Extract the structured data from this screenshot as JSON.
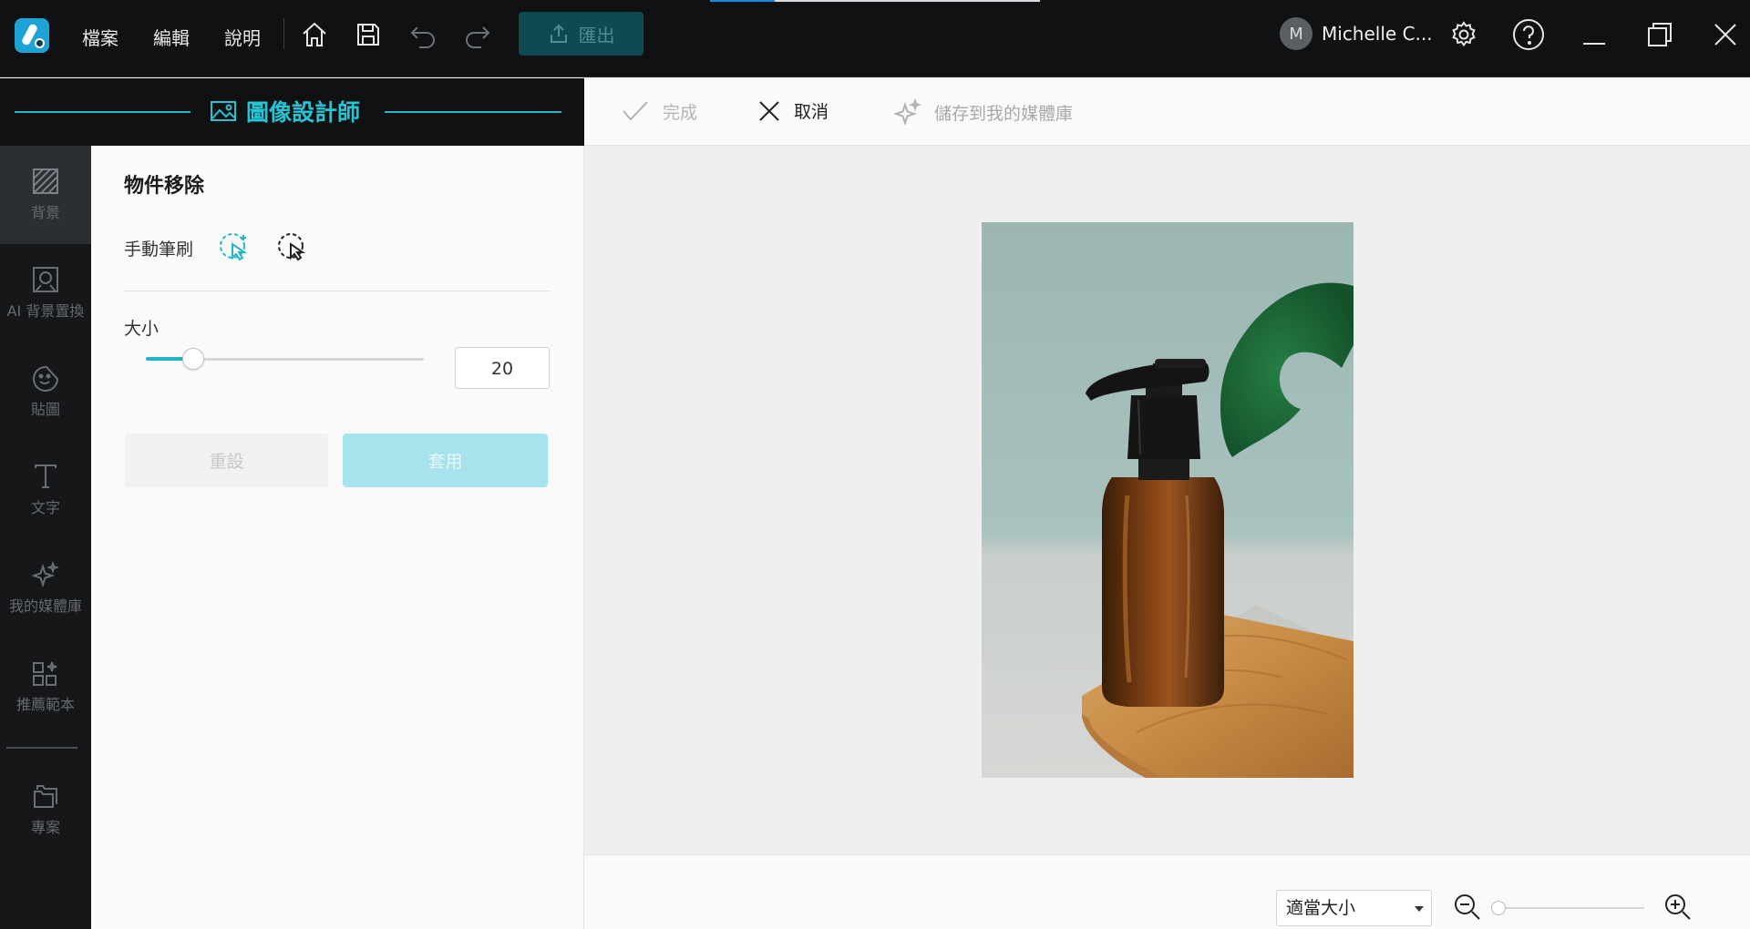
{
  "app": {
    "menu": [
      "檔案",
      "編輯",
      "說明"
    ],
    "export_label": "匯出",
    "user_initial": "M",
    "user_name": "Michelle C...",
    "loading_progress": 0.196
  },
  "designer": {
    "title": "圖像設計師"
  },
  "rail": {
    "items": [
      {
        "label": "背景",
        "icon": "background-pattern-icon"
      },
      {
        "label": "AI 背景置換",
        "icon": "ai-background-replace-icon"
      },
      {
        "label": "貼圖",
        "icon": "sticker-icon"
      },
      {
        "label": "文字",
        "icon": "text-icon"
      },
      {
        "label": "我的媒體庫",
        "icon": "sparkle-media-icon"
      },
      {
        "label": "推薦範本",
        "icon": "template-icon"
      },
      {
        "label": "專案",
        "icon": "folder-icon"
      }
    ]
  },
  "panel": {
    "title": "物件移除",
    "brush_label": "手動筆刷",
    "size_label": "大小",
    "size_value": "20",
    "size_fraction": 0.17,
    "reset_label": "重設",
    "apply_label": "套用"
  },
  "actions": {
    "done_label": "完成",
    "cancel_label": "取消",
    "save_label": "儲存到我的媒體庫"
  },
  "zoom": {
    "fit_label": "適當大小",
    "slider_fraction": 0.0
  },
  "colors": {
    "accent": "#22b7c8",
    "titlebar_bg": "#0f1113",
    "export_bg": "#0f4a52",
    "apply_bg": "#a7e3ec"
  }
}
